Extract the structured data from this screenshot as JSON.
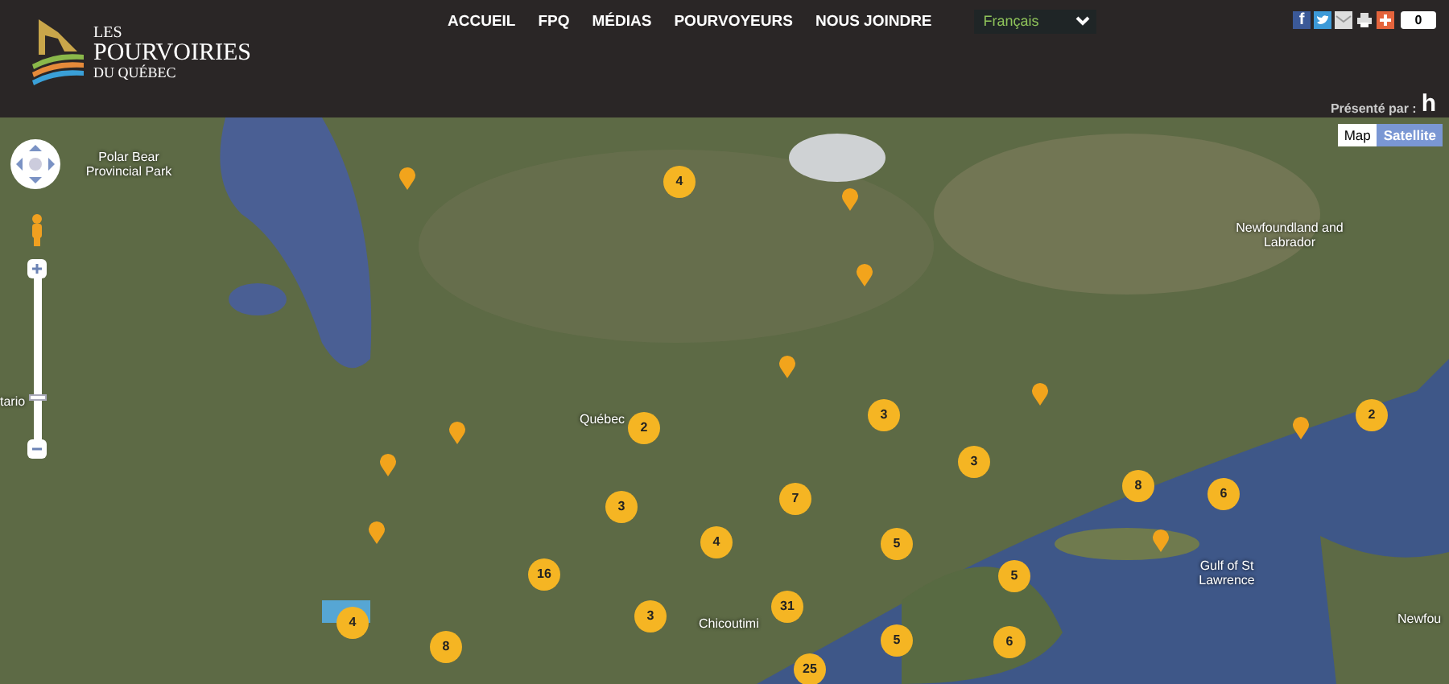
{
  "logo": {
    "line_1": "LES",
    "line_2": "POURVOIRIES",
    "line_3": "DU QUÉBEC"
  },
  "nav": [
    "ACCUEIL",
    "FPQ",
    "MÉDIAS",
    "POURVOYEURS",
    "NOUS JOINDRE"
  ],
  "language_select": {
    "value": "Français"
  },
  "share": {
    "facebook_letter": "f",
    "count": "0"
  },
  "sponsor": {
    "label": "Présenté par :",
    "logo_letter": "h"
  },
  "map": {
    "type_buttons": [
      {
        "label": "Map",
        "selected": false
      },
      {
        "label": "Satellite",
        "selected": true
      }
    ],
    "labels": [
      "Polar Bear Provincial Park",
      "Newfoundland and Labrador",
      "Québec",
      "Gulf of St Lawrence",
      "Chicoutimi",
      "Newfou",
      "tario"
    ],
    "clusters": [
      "4",
      "2",
      "3",
      "2",
      "3",
      "8",
      "6",
      "3",
      "7",
      "4",
      "5",
      "16",
      "5",
      "4",
      "3",
      "31",
      "8",
      "5",
      "6",
      "25"
    ],
    "zoom": {
      "level": 0.25
    }
  }
}
